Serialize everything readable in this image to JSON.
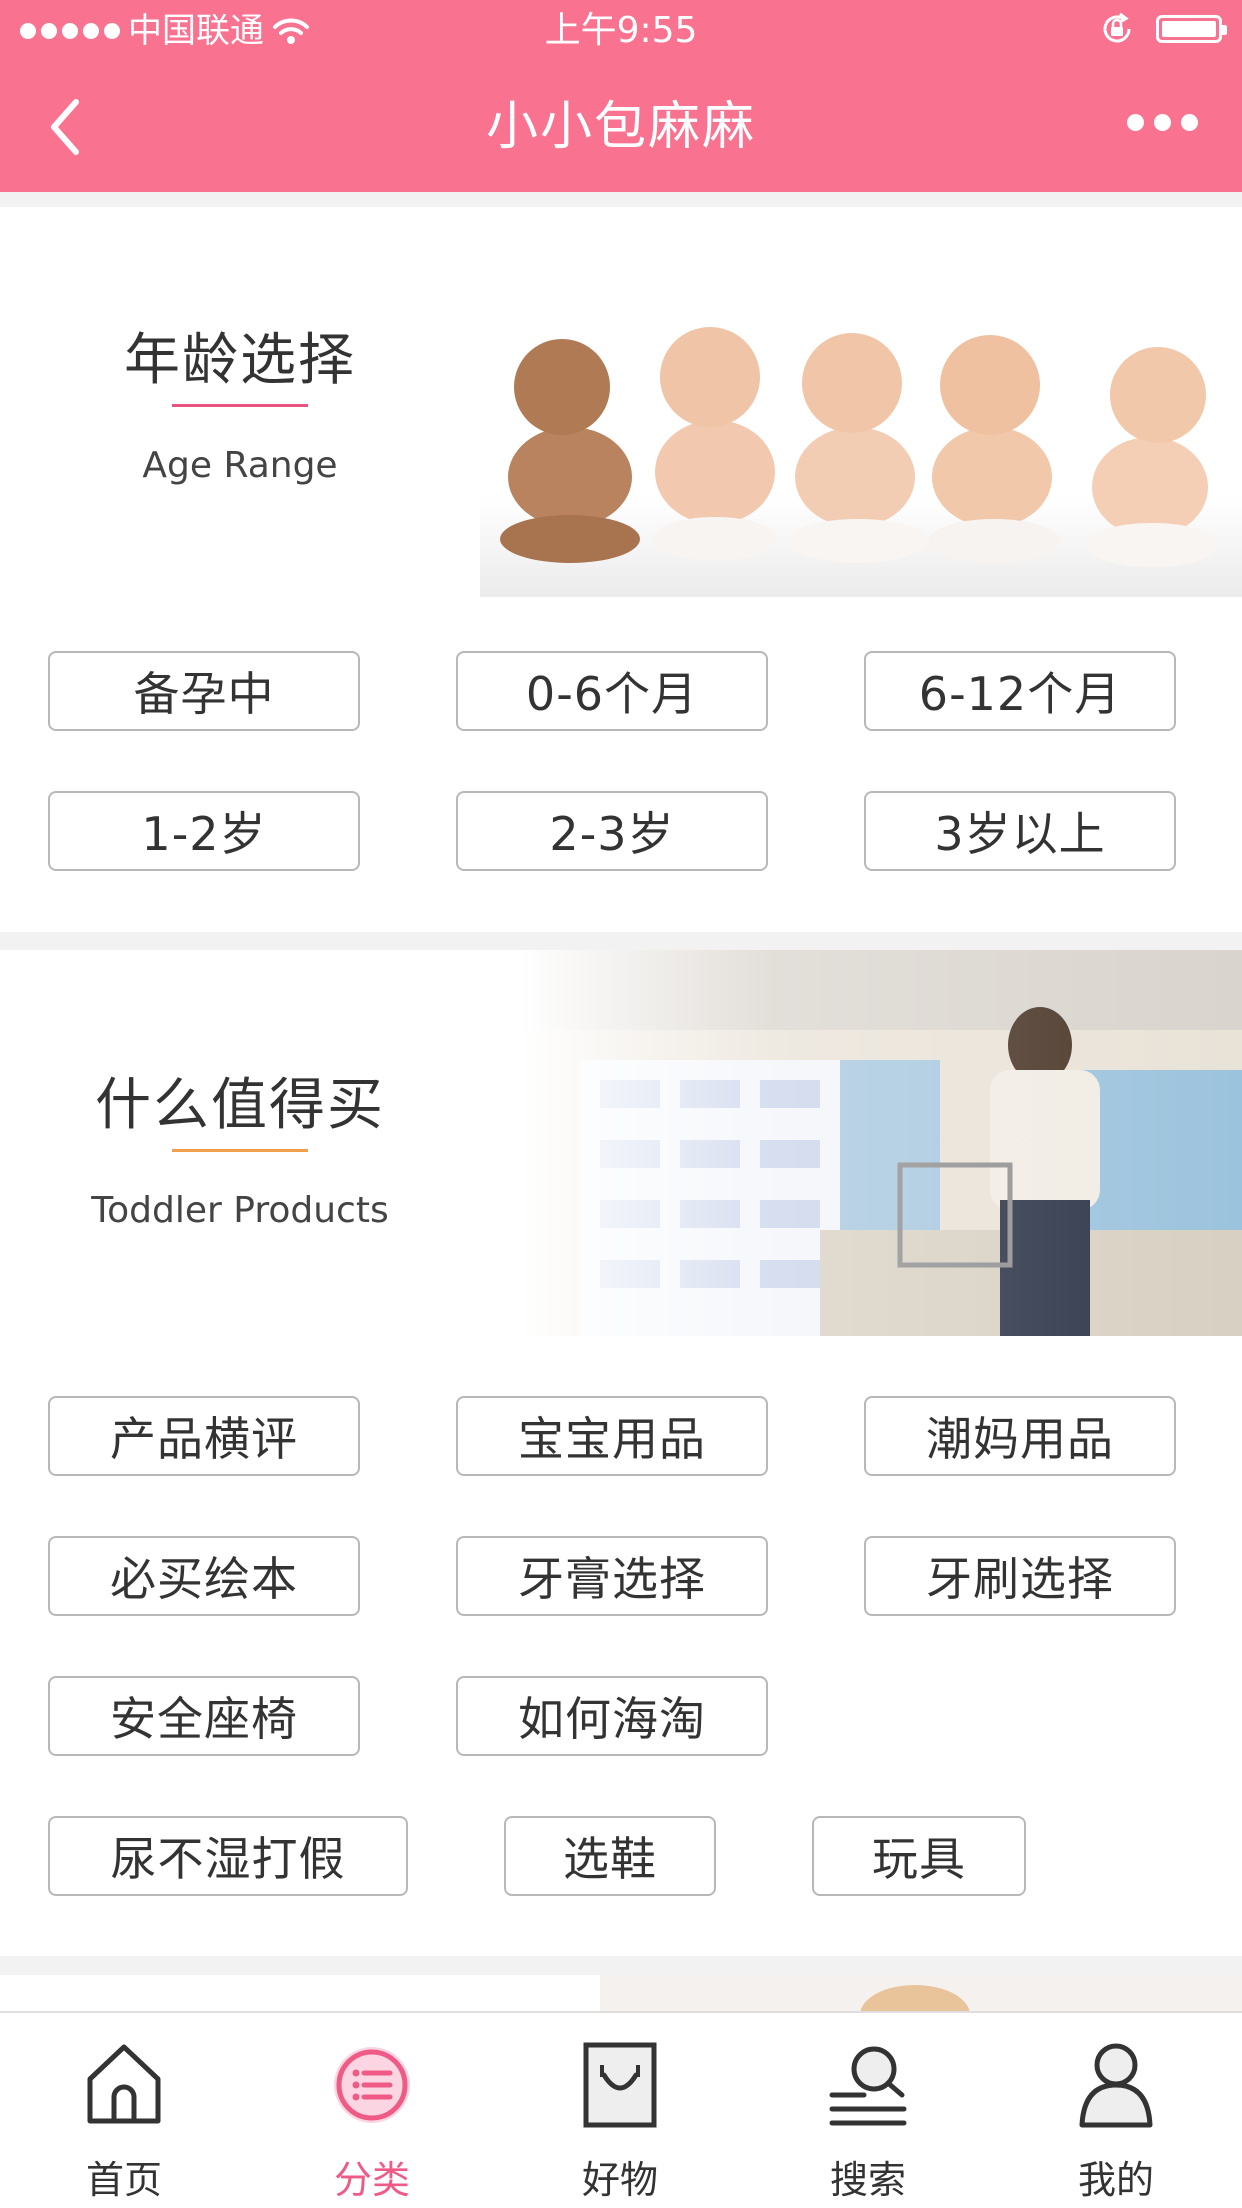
{
  "status_bar": {
    "carrier": "中国联通",
    "time": "上午9:55"
  },
  "nav": {
    "title": "小小包麻麻"
  },
  "age_section": {
    "title": "年龄选择",
    "subtitle": "Age Range",
    "accent_color": "#e8547f",
    "tags": [
      "备孕中",
      "0-6个月",
      "6-12个月",
      "1-2岁",
      "2-3岁",
      "3岁以上"
    ]
  },
  "products_section": {
    "title": "什么值得买",
    "subtitle": "Toddler Products",
    "accent_color": "#f0a04a",
    "tags": [
      "产品横评",
      "宝宝用品",
      "潮妈用品",
      "必买绘本",
      "牙膏选择",
      "牙刷选择",
      "安全座椅",
      "如何海淘",
      "尿不湿打假",
      "选鞋",
      "玩具"
    ]
  },
  "tab_bar": {
    "items": [
      {
        "label": "首页",
        "icon": "home-icon"
      },
      {
        "label": "分类",
        "icon": "category-icon"
      },
      {
        "label": "好物",
        "icon": "bag-icon"
      },
      {
        "label": "搜索",
        "icon": "search-icon"
      },
      {
        "label": "我的",
        "icon": "user-icon"
      }
    ],
    "active_index": 1
  },
  "colors": {
    "brand": "#f9728f",
    "active_tab": "#f05a86"
  }
}
